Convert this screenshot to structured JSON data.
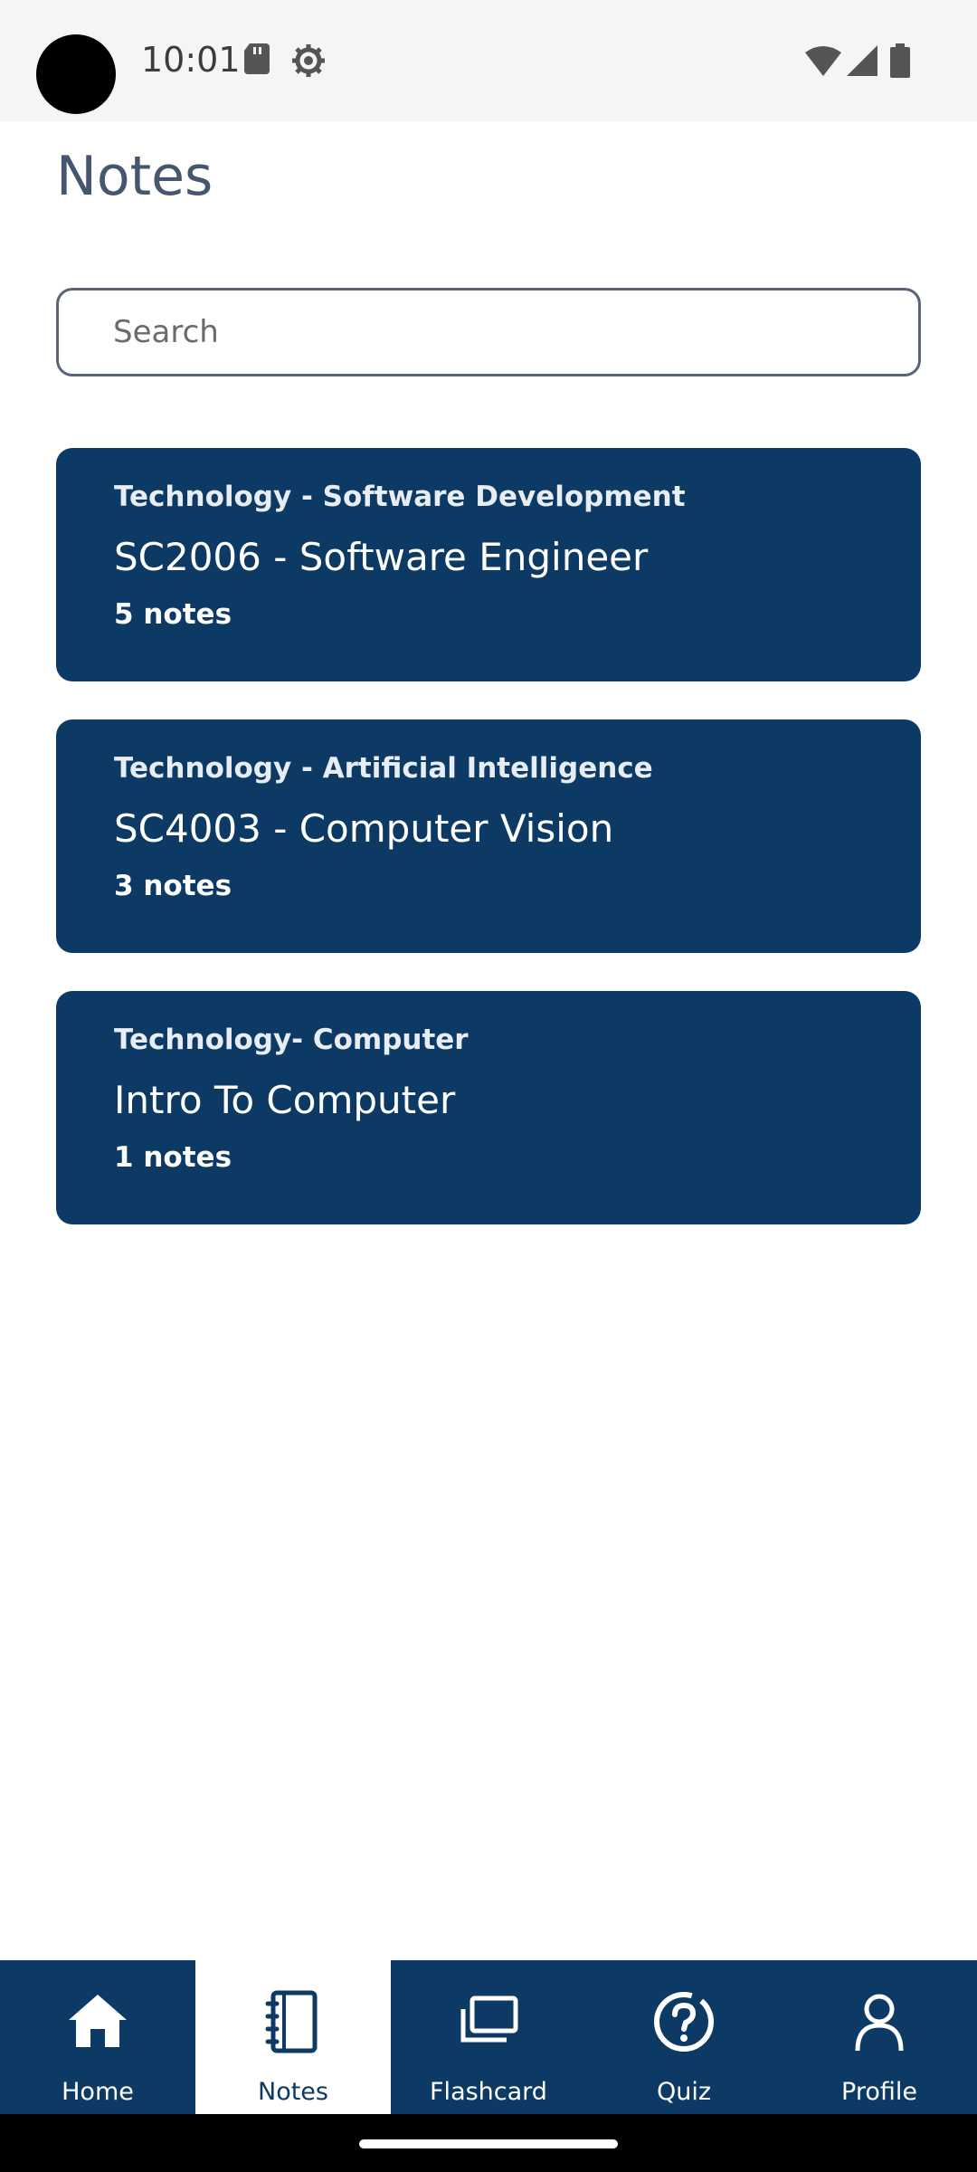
{
  "status_bar": {
    "time": "10:01"
  },
  "header": {
    "title": "Notes"
  },
  "search": {
    "placeholder": "Search",
    "value": ""
  },
  "cards": [
    {
      "category": "Technology - Software Development",
      "title": "SC2006 - Software Engineer",
      "count": "5 notes"
    },
    {
      "category": "Technology - Artificial Intelligence",
      "title": "SC4003 - Computer Vision",
      "count": "3 notes"
    },
    {
      "category": "Technology-  Computer",
      "title": "Intro To Computer",
      "count": "1 notes"
    }
  ],
  "bottom_nav": {
    "items": [
      {
        "label": "Home",
        "icon": "home-icon"
      },
      {
        "label": "Notes",
        "icon": "notebook-icon",
        "active": true
      },
      {
        "label": "Flashcard",
        "icon": "cards-icon"
      },
      {
        "label": "Quiz",
        "icon": "question-icon"
      },
      {
        "label": "Profile",
        "icon": "person-icon"
      }
    ]
  },
  "colors": {
    "primary": "#0c3a65",
    "title": "#46566e",
    "status_bar_bg": "#f5f5f5"
  }
}
